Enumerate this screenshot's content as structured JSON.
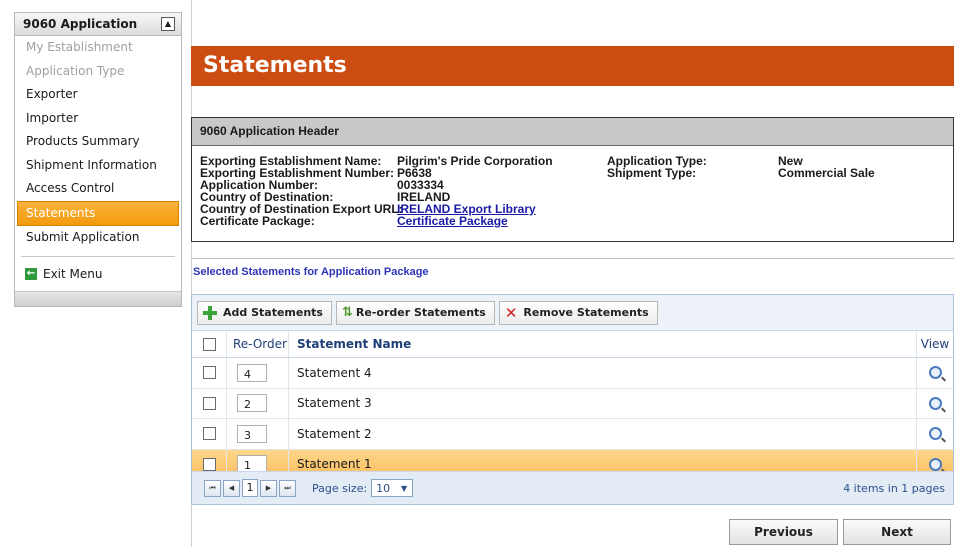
{
  "sidebar": {
    "title": "9060 Application",
    "items": [
      {
        "label": "My Establishment",
        "state": "disabled"
      },
      {
        "label": "Application Type",
        "state": "disabled"
      },
      {
        "label": "Exporter",
        "state": "normal"
      },
      {
        "label": "Importer",
        "state": "normal"
      },
      {
        "label": "Products Summary",
        "state": "normal"
      },
      {
        "label": "Shipment Information",
        "state": "normal"
      },
      {
        "label": "Access Control",
        "state": "normal"
      },
      {
        "label": "Statements",
        "state": "active"
      },
      {
        "label": "Submit Application",
        "state": "normal"
      }
    ],
    "exit_label": "Exit Menu"
  },
  "page_title": "Statements",
  "header": {
    "title": "9060 Application Header",
    "labels": {
      "est_name": "Exporting Establishment Name:",
      "est_number": "Exporting Establishment Number:",
      "app_number": "Application Number:",
      "country": "Country of Destination:",
      "export_url": "Country of Destination Export URL:",
      "cert_package": "Certificate Package:",
      "app_type": "Application Type:",
      "ship_type": "Shipment Type:"
    },
    "values": {
      "est_name": "Pilgrim's Pride Corporation",
      "est_number": "P6638",
      "app_number": "0033334",
      "country": "IRELAND",
      "export_url": "IRELAND Export Library",
      "cert_package": "Certificate Package",
      "app_type": "New",
      "ship_type": "Commercial Sale"
    }
  },
  "section_title": "Selected Statements for Application Package",
  "toolbar": {
    "add": "Add Statements",
    "reorder": "Re-order Statements",
    "remove": "Remove Statements"
  },
  "grid": {
    "columns": {
      "reorder": "Re-Order",
      "name": "Statement Name",
      "view": "View"
    },
    "rows": [
      {
        "order": "4",
        "name": "Statement 4",
        "selected": false
      },
      {
        "order": "2",
        "name": "Statement 3",
        "selected": false
      },
      {
        "order": "3",
        "name": "Statement 2",
        "selected": false
      },
      {
        "order": "1",
        "name": "Statement 1",
        "selected": true
      }
    ]
  },
  "pager": {
    "current_page": "1",
    "page_size_label": "Page size:",
    "page_size": "10",
    "info": "4 items in 1 pages"
  },
  "buttons": {
    "previous": "Previous",
    "next": "Next"
  },
  "colors": {
    "accent": "#cb4d12",
    "active_nav": "#f9a825"
  }
}
